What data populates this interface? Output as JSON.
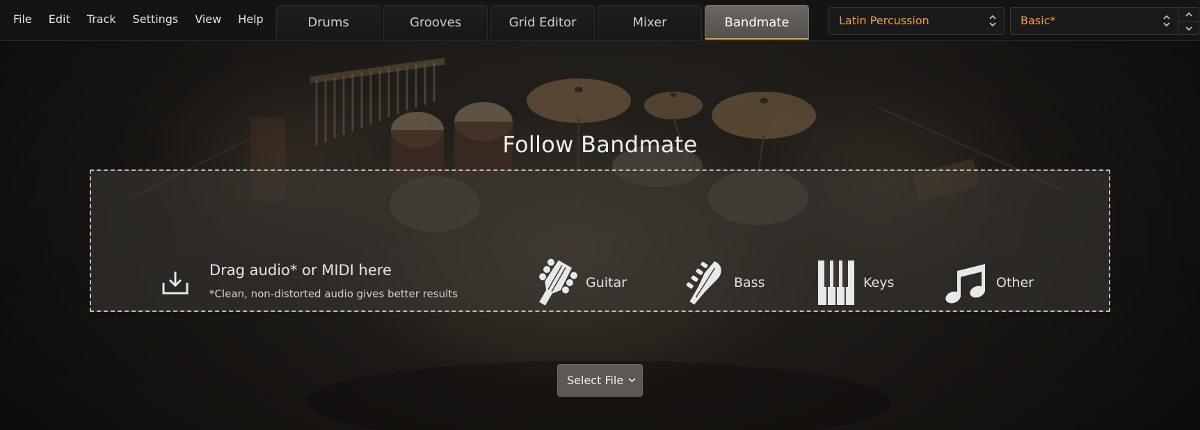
{
  "menu": [
    "File",
    "Edit",
    "Track",
    "Settings",
    "View",
    "Help"
  ],
  "tabs": [
    "Drums",
    "Grooves",
    "Grid Editor",
    "Mixer",
    "Bandmate"
  ],
  "active_tab": "Bandmate",
  "kit_select": {
    "value": "Latin Percussion"
  },
  "preset_select": {
    "value": "Basic*"
  },
  "main": {
    "title": "Follow Bandmate",
    "drop_zone": {
      "main_text": "Drag audio* or MIDI here",
      "note_text": "*Clean, non-distorted audio gives better results",
      "instruments": [
        {
          "label": "Guitar",
          "icon": "guitar-headstock-icon"
        },
        {
          "label": "Bass",
          "icon": "bass-headstock-icon"
        },
        {
          "label": "Keys",
          "icon": "piano-keys-icon"
        },
        {
          "label": "Other",
          "icon": "music-note-icon"
        }
      ]
    },
    "select_file_label": "Select File"
  },
  "colors": {
    "accent": "#f0a048",
    "active_tab_underline": "#e3a34a",
    "background": "#1b1916",
    "topbar": "#141414"
  }
}
